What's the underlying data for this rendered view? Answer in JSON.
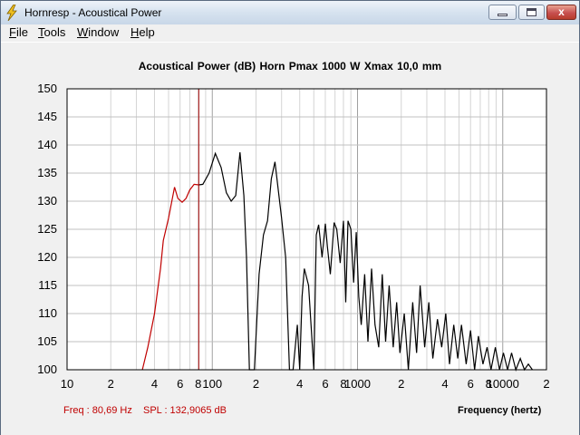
{
  "window": {
    "title": "Hornresp - Acoustical Power",
    "buttons": {
      "minimize": "minimize",
      "maximize": "maximize",
      "close": "x"
    }
  },
  "menu": [
    {
      "label": "File",
      "accel": "F",
      "rest": "ile"
    },
    {
      "label": "Tools",
      "accel": "T",
      "rest": "ools"
    },
    {
      "label": "Window",
      "accel": "W",
      "rest": "indow"
    },
    {
      "label": "Help",
      "accel": "H",
      "rest": "elp"
    }
  ],
  "chart": {
    "title": "Acoustical Power (dB)   Horn   Pmax 1000 W   Xmax 10,0 mm",
    "xlabel": "Frequency (hertz)",
    "readout": {
      "freq": "Freq : 80,69 Hz",
      "spl": "SPL : 132,9065 dB"
    }
  },
  "chart_data": {
    "type": "line",
    "title": "Acoustical Power (dB)   Horn   Pmax 1000 W   Xmax 10,0 mm",
    "xlabel": "Frequency (hertz)",
    "ylabel": "",
    "xscale": "log",
    "xlim": [
      10,
      20000
    ],
    "ylim": [
      100,
      150
    ],
    "y_ticks": [
      "150",
      "145",
      "140",
      "135",
      "130",
      "125",
      "120",
      "115",
      "110",
      "105",
      "100"
    ],
    "x_ticks": [
      {
        "v": 10,
        "label": "10"
      },
      {
        "v": 20,
        "label": "2"
      },
      {
        "v": 40,
        "label": "4"
      },
      {
        "v": 60,
        "label": "6"
      },
      {
        "v": 80,
        "label": "8"
      },
      {
        "v": 100,
        "label": "100"
      },
      {
        "v": 200,
        "label": "2"
      },
      {
        "v": 400,
        "label": "4"
      },
      {
        "v": 600,
        "label": "6"
      },
      {
        "v": 800,
        "label": "8"
      },
      {
        "v": 1000,
        "label": "1000"
      },
      {
        "v": 2000,
        "label": "2"
      },
      {
        "v": 4000,
        "label": "4"
      },
      {
        "v": 6000,
        "label": "6"
      },
      {
        "v": 8000,
        "label": "8"
      },
      {
        "v": 10000,
        "label": "10000"
      },
      {
        "v": 20000,
        "label": "2"
      }
    ],
    "grid": true,
    "cursor_freq": 80.69,
    "cursor_spl": 132.9065,
    "colors": {
      "below_cursor": "#c00000",
      "above_cursor": "#000000",
      "cursor": "#a00000",
      "grid": "#c8c8c8"
    },
    "series": [
      {
        "x": [
          33,
          36,
          40,
          44,
          46,
          50,
          55,
          58,
          62,
          66,
          70,
          75,
          80.69,
          86,
          95,
          105,
          115,
          125,
          135,
          145,
          155,
          165,
          172,
          180,
          195,
          210,
          225,
          240,
          255,
          270,
          300,
          320,
          340,
          360,
          385,
          400,
          415,
          430,
          460,
          500,
          520,
          540,
          570,
          600,
          620,
          650,
          690,
          720,
          760,
          800,
          830,
          860,
          900,
          940,
          980,
          1020,
          1060,
          1120,
          1180,
          1250,
          1320,
          1400,
          1480,
          1560,
          1650,
          1760,
          1860,
          1960,
          2100,
          2240,
          2400,
          2550,
          2700,
          2900,
          3100,
          3300,
          3550,
          3800,
          4050,
          4300,
          4600,
          4900,
          5200,
          5600,
          6000,
          6400,
          6800,
          7300,
          7800,
          8300,
          8900,
          9500,
          10100,
          10800,
          11500,
          12300,
          13200,
          14100,
          15000,
          16000
        ],
        "y": [
          100,
          104,
          110,
          118,
          123,
          127,
          132.5,
          130.5,
          129.8,
          130.5,
          132,
          133,
          132.9,
          133,
          135,
          138.5,
          136,
          131.5,
          130,
          131,
          138.7,
          131,
          120,
          100,
          100,
          117,
          124,
          126.5,
          134,
          137,
          127,
          120,
          100,
          100,
          108,
          100,
          113,
          118,
          115,
          100,
          124,
          125.8,
          120,
          126,
          122,
          117,
          126.2,
          125,
          119,
          126.5,
          112,
          126.5,
          125,
          115.5,
          124.5,
          113,
          108,
          117,
          105,
          118,
          108,
          104,
          117,
          105,
          115,
          104,
          112,
          103,
          110,
          100,
          112,
          103,
          115,
          104,
          112,
          102,
          109,
          104,
          110,
          101,
          108,
          102,
          108,
          101,
          107,
          100,
          106,
          101,
          104,
          100,
          104,
          100,
          103,
          100,
          103,
          100,
          102,
          100,
          101,
          100
        ]
      }
    ]
  }
}
